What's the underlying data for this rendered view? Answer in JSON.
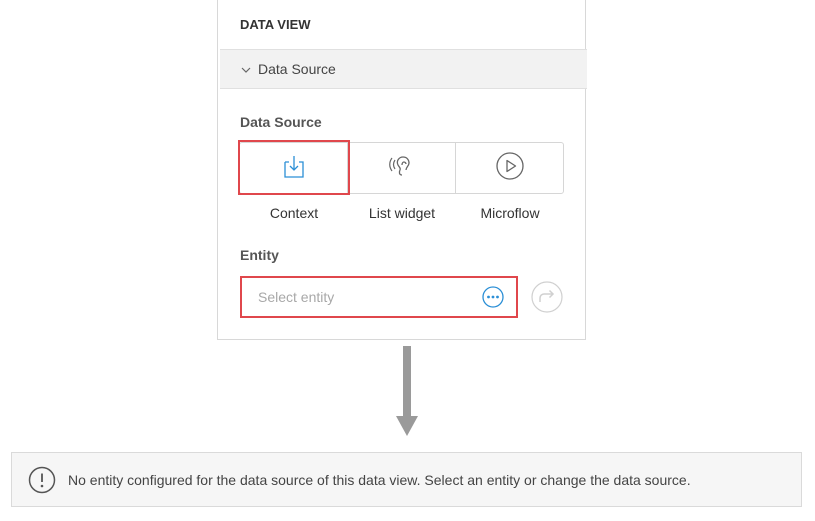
{
  "panel": {
    "title": "DATA VIEW",
    "section": "Data Source",
    "data_source_label": "Data Source",
    "options": [
      {
        "label": "Context",
        "icon": "download-icon",
        "selected": true
      },
      {
        "label": "List widget",
        "icon": "ear-icon",
        "selected": false
      },
      {
        "label": "Microflow",
        "icon": "play-circle-icon",
        "selected": false
      }
    ],
    "entity_label": "Entity",
    "entity_placeholder": "Select entity"
  },
  "alert": {
    "message": "No entity configured for the data source of this data view. Select an entity or change the data source."
  },
  "colors": {
    "highlight": "#e0474c",
    "accent": "#2b8fd6"
  }
}
